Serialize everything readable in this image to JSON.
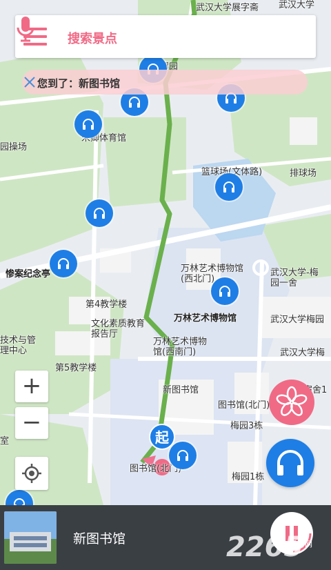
{
  "search": {
    "placeholder": "搜索景点"
  },
  "notice": {
    "text": "您到了：新图书馆"
  },
  "map_labels": {
    "top_street": "武汉大学展字斋",
    "top_right": "武汉大学",
    "yingyuan": "樱园",
    "sports_hall": "宋卿体育馆",
    "field": "园操场",
    "basketball": "篮球场(文体路)",
    "volleyball": "排球场",
    "memorial": "惨案纪念亭",
    "wanlin_west": "万林艺术博物馆(西北门)",
    "wuda_meiyuan1": "武汉大学-梅园一舍",
    "building4": "第4教学楼",
    "wanlin": "万林艺术博物馆",
    "report_hall": "文化素质教育报告厅",
    "meiyuan": "武汉大学梅园",
    "tech_center": "技术与管理中心",
    "wanlin_sw": "万林艺术博物馆(西南门)",
    "wuda_meiyuan": "武汉大学梅",
    "building5": "第5教学楼",
    "new_library": "新图书馆",
    "lib_north": "图书馆(北门)",
    "meiyuan3": "梅园3栋",
    "dorm": "宿舍1",
    "meiyuan1": "梅园1栋",
    "lib_gate": "图书馆(北门)",
    "left_edge": "室"
  },
  "start_marker": "起",
  "zoom": {
    "in": "+",
    "out": "−"
  },
  "player": {
    "title": "新图书馆"
  },
  "watermark": {
    "brand": "2265",
    "sub": "手游网"
  },
  "colors": {
    "accent_pink": "#f06a86",
    "audio_blue": "#1e7ee6",
    "route_green": "#6ab04c"
  }
}
